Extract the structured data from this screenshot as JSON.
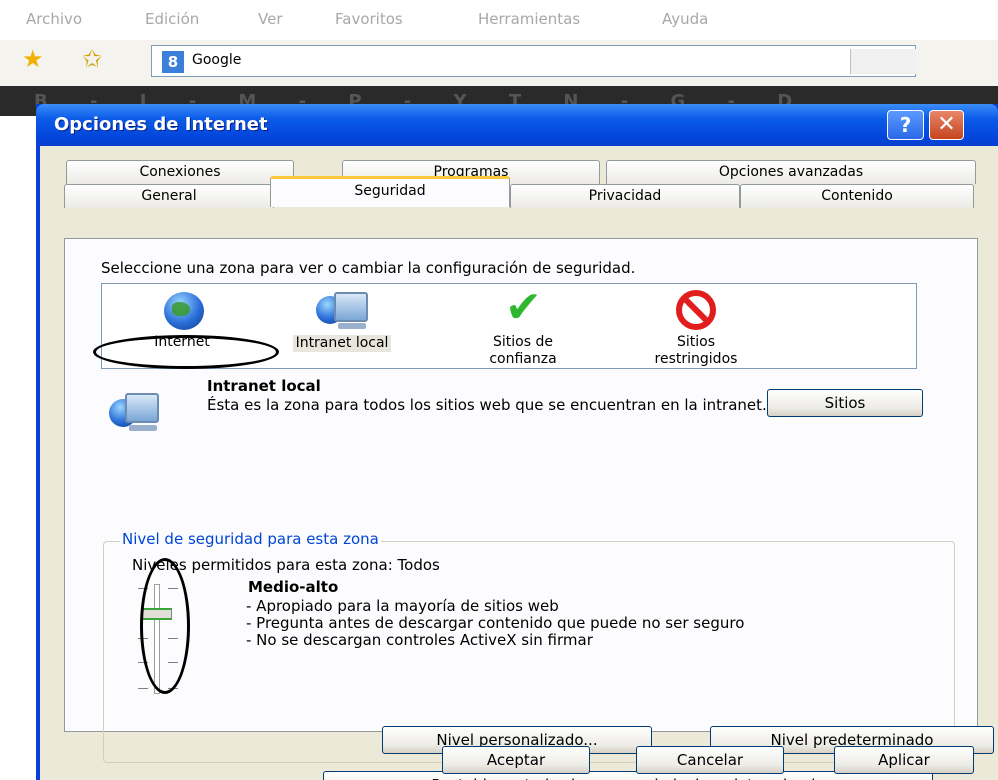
{
  "browser": {
    "menu": [
      "Archivo",
      "Edición",
      "Ver",
      "Favoritos",
      "Herramientas",
      "Ayuda"
    ],
    "address": "Google",
    "google_badge": "8"
  },
  "dialog": {
    "title": "Opciones de Internet",
    "help_label": "?",
    "close_label": "✕",
    "tabs_back": [
      "Conexiones",
      "Programas",
      "Opciones avanzadas"
    ],
    "tabs_front": [
      "General",
      "Seguridad",
      "Privacidad",
      "Contenido"
    ],
    "active_tab": "Seguridad",
    "zone_instruction": "Seleccione una zona para ver o cambiar la configuración de seguridad.",
    "zones": [
      {
        "label": "Internet",
        "icon": "globe-icon"
      },
      {
        "label": "Intranet local",
        "icon": "local-intranet-icon"
      },
      {
        "label": "Sitios de confianza",
        "icon": "trusted-check-icon"
      },
      {
        "label": "Sitios restringidos",
        "icon": "restricted-no-entry-icon"
      }
    ],
    "selected_zone_title": "Intranet local",
    "selected_zone_description": "Ésta es la zona para todos los sitios web que se encuentran en la intranet.",
    "sites_button": "Sitios",
    "security_level": {
      "legend": "Nivel de seguridad para esta zona",
      "allowed_levels": "Niveles permitidos para esta zona: Todos",
      "level_name": "Medio-alto",
      "level_details": [
        "- Apropiado para la mayoría de sitios web",
        "- Pregunta antes de descargar contenido que puede no ser seguro",
        "- No se descargan controles ActiveX sin firmar"
      ],
      "custom_level_button": "Nivel personalizado...",
      "default_level_button": "Nivel predeterminado"
    },
    "reset_all_button": "Restablecer todas las zonas al nivel predeterminado",
    "ok_button": "Aceptar",
    "cancel_button": "Cancelar",
    "apply_button": "Aplicar"
  },
  "colors": {
    "titlebar": "#0b5be8",
    "dialog_bg": "#ece9d8",
    "legend": "#0046d5",
    "active_tab_accent": "#ffc83c"
  }
}
